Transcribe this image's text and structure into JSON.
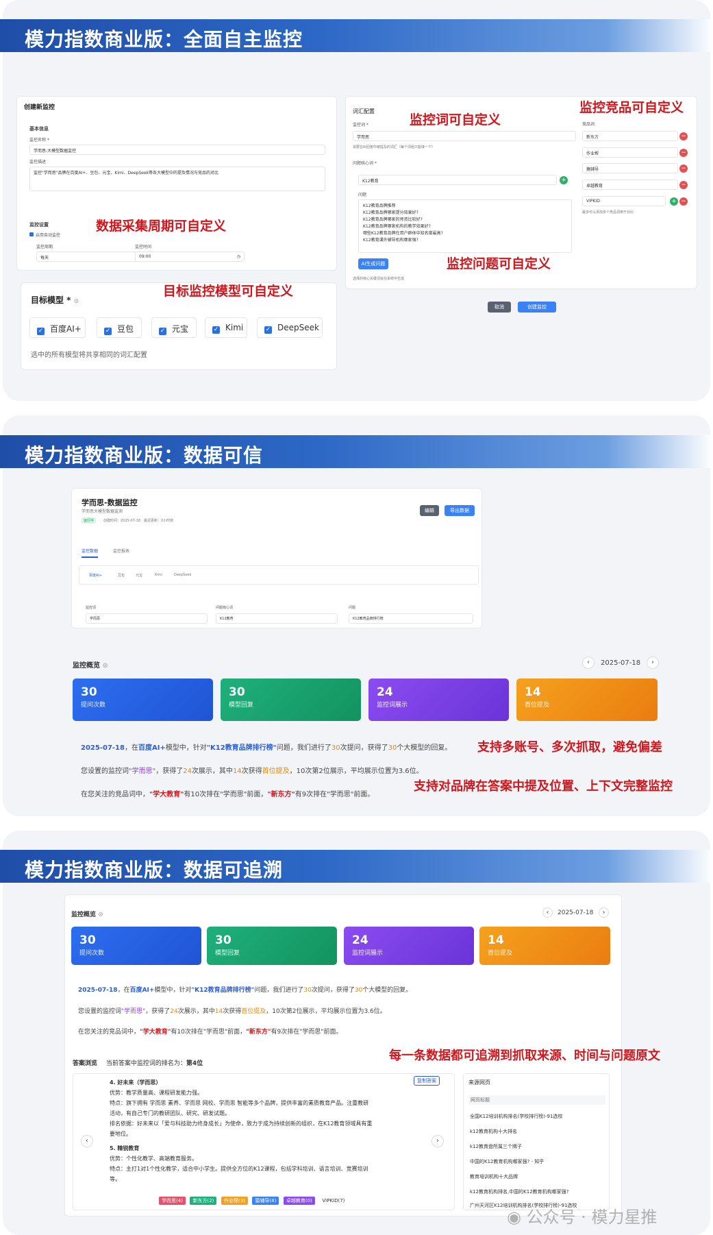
{
  "section1": {
    "banner_title": "模力指数商业版：全面自主监控",
    "create_form": {
      "title": "创建新监控",
      "basic_info": "基本信息",
      "name_label": "监控名称 *",
      "name_value": "学而思-大模型数据监控",
      "desc_label": "监控描述",
      "desc_value": "监控\"学而思\"品牌在百度AI+、豆包、元宝、Kimi、DeepSeek等各大模型中的提及情况与竞品的对比",
      "settings_label": "监控设置",
      "auto_monitor": "启用自动监控",
      "period_label": "监控周期",
      "period_value": "每天",
      "time_label": "监控时间",
      "time_value": "09:00"
    },
    "models": {
      "label": "目标模型 *",
      "items": [
        "百度AI+",
        "豆包",
        "元宝",
        "Kimi",
        "DeepSeek"
      ],
      "note": "选中的所有模型将共享相同的词汇配置"
    },
    "vocab": {
      "title": "词汇配置",
      "keyword_label": "监控词 *",
      "keyword_value": "学而思",
      "keyword_hint": "需要在AI回答中被提及的词汇（每个词组只能填一个）",
      "core_label": "问题核心词 *",
      "core_value": "K12教育",
      "question_label": "问题",
      "questions": [
        "K12教育品牌推荐",
        "K12教育品牌哪家提分效果好?",
        "K12教育品牌哪家的师资比较好?",
        "K12教育品牌哪家机构的教学效果好?",
        "哪些K12教育品牌在用户群体中知名度最高?",
        "K12教育课外辅导机构哪家强?"
      ],
      "gen_button": "AI生成问题",
      "gen_hint": "选择的核心关键词会在系统中生成"
    },
    "competitors": {
      "label": "竞品词",
      "items": [
        "新东方",
        "作业帮",
        "猿辅导",
        "卓越教育",
        "VIPKID"
      ],
      "hint": "最多可以添加多个竞品词用于对比"
    },
    "buttons": {
      "cancel": "取消",
      "create": "创建监控"
    },
    "notes": {
      "period": "数据采集周期可自定义",
      "model": "目标监控模型可自定义",
      "keyword": "监控词可自定义",
      "competitor": "监控竞品可自定义",
      "question": "监控问题可自定义"
    }
  },
  "section2": {
    "banner_title": "模力指数商业版：数据可信",
    "header": {
      "title": "学而思-数据监控",
      "subtitle": "学而思大模型数据监测",
      "status": "运行中",
      "meta": "创建时间：2025-07-18　最近更新：2小时前",
      "edit_button": "编辑",
      "export_button": "导出数据"
    },
    "tabs": [
      "监控数据",
      "监控报表"
    ],
    "model_tabs": [
      "百度AI+",
      "豆包",
      "元宝",
      "Kimi",
      "DeepSeek"
    ],
    "filters": [
      {
        "label": "监控词",
        "value": "学而思"
      },
      {
        "label": "问题核心词",
        "value": "K12教育"
      },
      {
        "label": "问题",
        "value": "K12教育品牌排行榜"
      }
    ],
    "overview_title": "监控概览",
    "date": "2025-07-18",
    "stats": [
      {
        "value": "30",
        "label": "提问次数"
      },
      {
        "value": "30",
        "label": "模型回复"
      },
      {
        "value": "24",
        "label": "监控词展示"
      },
      {
        "value": "14",
        "label": "首位提及"
      }
    ],
    "summary": {
      "line1_date": "2025-07-18",
      "line1_a": "，在",
      "line1_model": "百度AI+",
      "line1_b": "模型中，针对",
      "line1_q": "\"K12教育品牌排行榜\"",
      "line1_c": "问题，我们进行了",
      "line1_n1": "30",
      "line1_d": "次提问，获得了",
      "line1_n2": "30",
      "line1_e": "个大模型的回复。",
      "line2_a": "您设置的监控词",
      "line2_kw": "\"学而思\"",
      "line2_b": "，获得了",
      "line2_n1": "24",
      "line2_c": "次展示，其中",
      "line2_n2": "14",
      "line2_d": "次获得",
      "line2_first": "首位提及",
      "line2_e": "，10次第2位展示，平均展示位置为3.6位。",
      "line3_a": "在您关注的竞品词中，",
      "line3_c1": "\"学大教育\"",
      "line3_b": "有10次排在\"学而思\"前面，",
      "line3_c2": "\"新东方\"",
      "line3_d": "有9次排在\"学而思\"前面。"
    },
    "notes": {
      "accounts": "支持多账号、多次抓取，避免偏差",
      "position": "支持对品牌在答案中提及位置、上下文完整监控"
    }
  },
  "section3": {
    "banner_title": "模力指数商业版：数据可追溯",
    "overview_title": "监控概览",
    "date": "2025-07-18",
    "stats": [
      {
        "value": "30",
        "label": "提问次数"
      },
      {
        "value": "30",
        "label": "模型回复"
      },
      {
        "value": "24",
        "label": "监控词展示"
      },
      {
        "value": "14",
        "label": "首位提及"
      }
    ],
    "note": "每一条数据都可追溯到抓取来源、时间与问题原文",
    "answer": {
      "title": "答案浏览",
      "rank_text": "当前答案中监控词的排名为：",
      "rank_value": "第4位",
      "copy_button": "复制答案",
      "item4_title": "4. 好未来（学而思）",
      "item4_adv": "优势：教学质量高、课程研发能力强。",
      "item4_feat1": "特点：旗下拥有 学而思 素养、学而思 网校、学而思 智能等多个品牌，提供丰富的素质教育产品。注重教研",
      "item4_feat2": "活动，有自己专门的教研团队、研究、研发试题。",
      "item4_rank1": "排名依据：好未来以「爱与科技助力终身成长」为使命，致力于成为持续创新的组织，在K12教育领域具有重",
      "item4_rank2": "要地位。",
      "item5_title": "5. 精锐教育",
      "item5_adv": "优势：个性化教学、高端教育服务。",
      "item5_feat1": "特点：主打1对1个性化教学，适合中小学生。提供全方位的K12课程，包括学科培训、语言培训、竞赛培训",
      "item5_feat2": "等。",
      "tags": [
        "学而思(4)",
        "新东方(2)",
        "作业帮(3)",
        "猿辅导(8)",
        "卓越教育(0)",
        "VIPKID(7)"
      ]
    },
    "sources": {
      "title": "来源网页",
      "header": "网页标题",
      "items": [
        "全国K12培训机构排名(学校排行榜)-91选校",
        "k12教育机构十大排名",
        "k12教育盘所属三个牌子",
        "中国的K12教育机构哪家强? - 知乎",
        "教育培训机构十大品牌",
        "k12教育机构排名,中国的K12教育机构哪家强?",
        "广州天河区K12培训机构排名(学校排行榜)-91选校"
      ]
    }
  },
  "watermark": "公众号 · 模力星推",
  "colors": {
    "brand_blue": "#2a5ed4",
    "note_red": "#d0171d"
  }
}
